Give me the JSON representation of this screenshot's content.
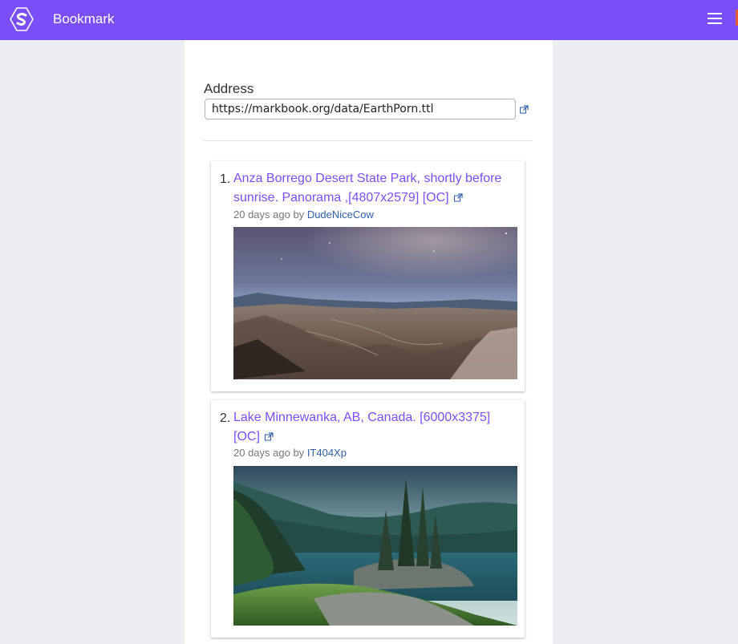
{
  "header": {
    "app_title": "Bookmark"
  },
  "address": {
    "label": "Address",
    "value": "https://markbook.org/data/EarthPorn.ttl"
  },
  "posts": [
    {
      "number": "1.",
      "title": "Anza Borrego Desert State Park, shortly before sunrise. Panorama ,[4807x2579] [OC]",
      "age": "20 days ago by",
      "author": "DudeNiceCow"
    },
    {
      "number": "2.",
      "title": "Lake Minnewanka, AB, Canada. [6000x3375] [OC]",
      "age": "20 days ago by",
      "author": "IT404Xp"
    }
  ],
  "colors": {
    "brand": "#7b4ff8",
    "link": "#2f5fa8",
    "background": "#ebedf0"
  }
}
